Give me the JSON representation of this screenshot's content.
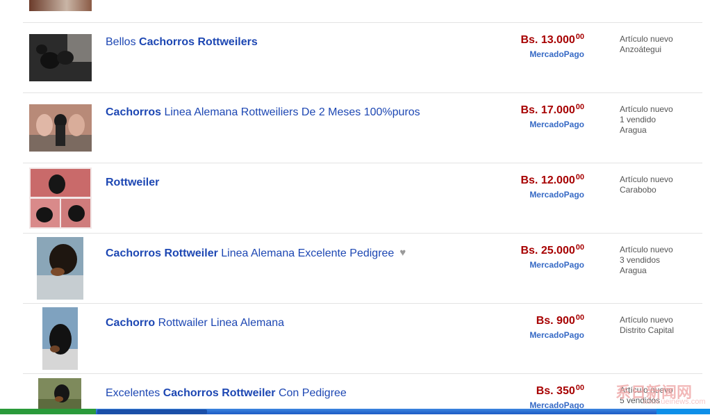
{
  "listings": [
    {
      "title_pre": "Bellos ",
      "title_bold": "Cachorros Rottweilers",
      "title_post": "",
      "price": "Bs. 13.000",
      "cents": "00",
      "payment": "MercadoPago",
      "meta": [
        "Artículo nuevo",
        "Anzoátegui"
      ],
      "thumb_icon": "puppy-photo"
    },
    {
      "title_pre": "",
      "title_bold": "Cachorros",
      "title_post": " Linea Alemana Rottweiliers De 2 Meses 100%puros",
      "price": "Bs. 17.000",
      "cents": "00",
      "payment": "MercadoPago",
      "meta": [
        "Artículo nuevo",
        "1 vendido",
        "Aragua"
      ],
      "thumb_icon": "puppy-photo"
    },
    {
      "title_pre": "",
      "title_bold": "Rottweiler",
      "title_post": "",
      "price": "Bs. 12.000",
      "cents": "00",
      "payment": "MercadoPago",
      "meta": [
        "Artículo nuevo",
        "Carabobo"
      ],
      "thumb_icon": "puppy-collage-photo"
    },
    {
      "title_pre": "",
      "title_bold": "Cachorros Rottweiler",
      "title_post": " Linea Alemana Excelente Pedigree",
      "price": "Bs. 25.000",
      "cents": "00",
      "payment": "MercadoPago",
      "meta": [
        "Artículo nuevo",
        "3 vendidos",
        "Aragua"
      ],
      "thumb_icon": "puppy-photo",
      "favorite_icon": "heart-icon"
    },
    {
      "title_pre": "",
      "title_bold": "Cachorro",
      "title_post": " Rottwailer Linea Alemana",
      "price": "Bs. 900",
      "cents": "00",
      "payment": "MercadoPago",
      "meta": [
        "Artículo nuevo",
        "Distrito Capital"
      ],
      "thumb_icon": "puppy-photo"
    },
    {
      "title_pre": "Excelentes ",
      "title_bold": "Cachorros Rottweiler",
      "title_post": " Con Pedigree",
      "price": "Bs. 350",
      "cents": "00",
      "payment": "MercadoPago",
      "meta": [
        "Artículo nuevo",
        "5 vendidos"
      ],
      "thumb_icon": "puppy-photo"
    }
  ],
  "watermark": {
    "text": "系日新闻网",
    "sub": "www.ueinews.com"
  },
  "colors": {
    "link": "#1d47b3",
    "price": "#a70000",
    "mercadopago": "#3569c5",
    "meta": "#555555",
    "separator": "#e3e3e3"
  }
}
